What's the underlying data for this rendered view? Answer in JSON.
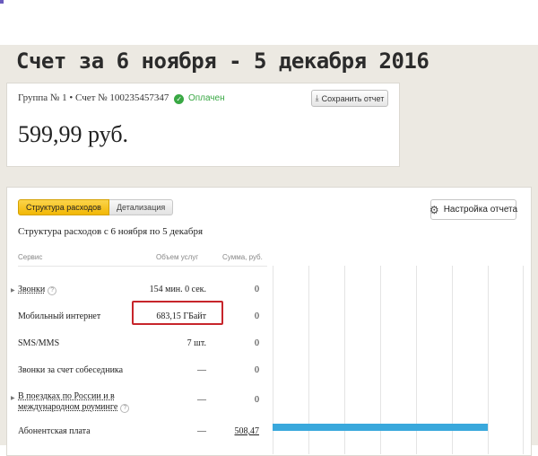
{
  "page_title": "Счет за 6 ноября - 5 декабря 2016",
  "invoice": {
    "account_line": "Группа № 1 • Счет № 100235457347",
    "status_label": "Оплачен",
    "save_button_label": "Сохранить отчет",
    "amount": "599,99 руб."
  },
  "structure": {
    "tabs": [
      {
        "label": "Структура расходов",
        "active": true
      },
      {
        "label": "Детализация",
        "active": false
      }
    ],
    "report_settings_label": "Настройка отчета",
    "title": "Структура расходов с 6 ноября по 5 декабря",
    "columns": {
      "service": "Сервис",
      "volume": "Объем услуг",
      "sum": "Сумма, руб."
    },
    "rows": [
      {
        "service": "Звонки",
        "volume": "154 мин. 0 сек.",
        "sum": "0"
      },
      {
        "service": "Мобильный интернет",
        "volume": "683,15 ГБайт",
        "sum": "0"
      },
      {
        "service": "SMS/MMS",
        "volume": "7 шт.",
        "sum": "0"
      },
      {
        "service": "Звонки за счет собеседника",
        "volume": "—",
        "sum": "0"
      },
      {
        "service_line1": "В поездках по России и в",
        "service_line2": "международном роуминге",
        "volume": "—",
        "sum": "0"
      },
      {
        "service": "Абонентская плата",
        "volume": "—",
        "sum": "508,47"
      }
    ],
    "chart": {
      "max_value": 508.47,
      "values": [
        0,
        0,
        0,
        0,
        0,
        508.47
      ]
    }
  },
  "colors": {
    "accent_yellow": "#f2b705",
    "paid_green": "#39a844",
    "bar_blue": "#39a8dc",
    "highlight_red": "#c7252b"
  }
}
